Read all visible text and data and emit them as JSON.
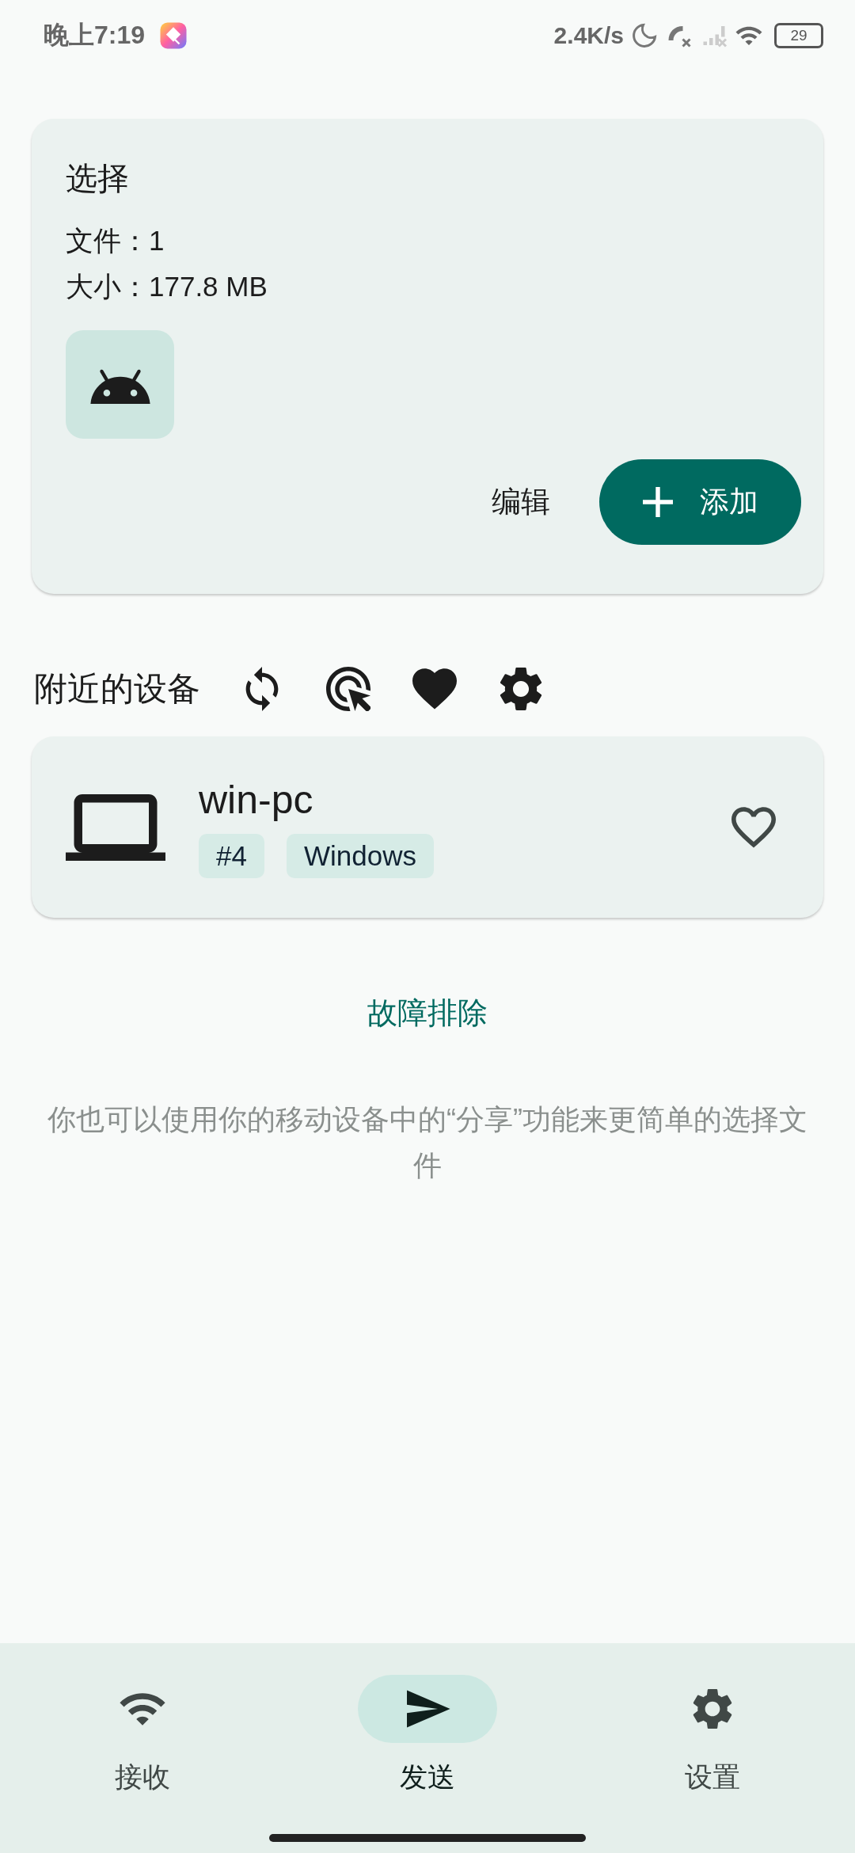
{
  "status_bar": {
    "time": "晚上7:19",
    "net_speed": "2.4K/s",
    "battery": "29"
  },
  "selection": {
    "title": "选择",
    "files": "文件：1",
    "size": "大小：177.8 MB",
    "edit_button": "编辑",
    "add_button": "添加"
  },
  "nearby": {
    "title": "附近的设备",
    "devices": [
      {
        "name": "win-pc",
        "tags": [
          "#4",
          "Windows"
        ],
        "favorite": false
      }
    ]
  },
  "troubleshoot_link": "故障排除",
  "hint": "你也可以使用你的移动设备中的“分享”功能来更简单的选择文件",
  "nav": [
    {
      "label": "接收",
      "selected": false
    },
    {
      "label": "发送",
      "selected": true
    },
    {
      "label": "设置",
      "selected": false
    }
  ]
}
